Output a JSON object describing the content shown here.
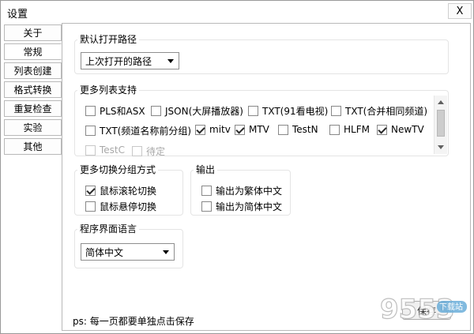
{
  "window": {
    "title": "设置",
    "close_label": "X"
  },
  "sidebar": {
    "items": [
      {
        "label": "关于"
      },
      {
        "label": "常规"
      },
      {
        "label": "列表创建"
      },
      {
        "label": "格式转换"
      },
      {
        "label": "重复检查"
      },
      {
        "label": "实验"
      },
      {
        "label": "其他"
      }
    ],
    "active_index": 1
  },
  "default_path": {
    "legend": "默认打开路径",
    "selected": "上次打开的路径"
  },
  "more_lists": {
    "legend": "更多列表支持",
    "options": [
      {
        "label": "PLS和ASX",
        "checked": false
      },
      {
        "label": "JSON(大屏播放器)",
        "checked": false
      },
      {
        "label": "TXT(91看电视)",
        "checked": false
      },
      {
        "label": "TXT(合并相同频道)",
        "checked": false
      },
      {
        "label": "TXT(频道名称前分组)",
        "checked": false
      },
      {
        "label": "mitv",
        "checked": true
      },
      {
        "label": "MTV",
        "checked": true
      },
      {
        "label": "TestN",
        "checked": false
      },
      {
        "label": "HLFM",
        "checked": false
      },
      {
        "label": "NewTV",
        "checked": true
      },
      {
        "label": "TestC",
        "checked": false,
        "disabled": true
      },
      {
        "label": "待定",
        "checked": false,
        "disabled": true
      }
    ]
  },
  "switch_group": {
    "legend": "更多切换分组方式",
    "options": [
      {
        "label": "鼠标滚轮切换",
        "checked": true
      },
      {
        "label": "鼠标悬停切换",
        "checked": false
      }
    ]
  },
  "output": {
    "legend": "输出",
    "options": [
      {
        "label": "输出为繁体中文",
        "checked": false
      },
      {
        "label": "输出为简体中文",
        "checked": false
      }
    ]
  },
  "language": {
    "legend": "程序界面语言",
    "selected": "简体中文"
  },
  "footer": {
    "note": "ps: 每一页都要单独点击保存",
    "save_label": "保存"
  },
  "watermark": {
    "text": "9553",
    "sub": "下载站"
  }
}
